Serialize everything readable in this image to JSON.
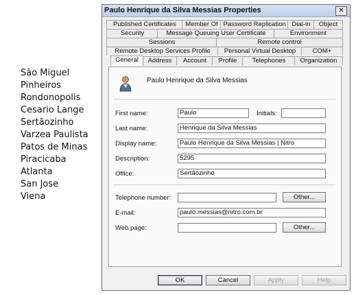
{
  "cities": [
    "São Miguel",
    "Pinheiros",
    "Rondonopolis",
    "Cesario Lange",
    "Sertãozinho",
    "Varzea Paulista",
    "Patos de Minas",
    "Piracicaba",
    "Atlanta",
    "San Jose",
    "Viena"
  ],
  "dialog": {
    "title": "Paulo Henrique da Silva Messias Properties",
    "close_glyph": "✕",
    "tabs_row1": [
      "Published Certificates",
      "Member Of",
      "Password Replication",
      "Dial-in",
      "Object"
    ],
    "tabs_row2": [
      "Security",
      "Message Queuing User Certificate",
      "Environment"
    ],
    "tabs_row3": [
      "Sessions",
      "Remote control"
    ],
    "tabs_row4": [
      "Remote Desktop Services Profile",
      "Personal Virtual Desktop",
      "COM+"
    ],
    "tabs_row5": [
      "General",
      "Address",
      "Account",
      "Profile",
      "Telephones",
      "Organization"
    ],
    "active_tab": "General",
    "user_display": "Paulo Henrique da Silva Messias",
    "labels": {
      "first_name": "First name:",
      "initials": "Initials:",
      "last_name": "Last name:",
      "display_name": "Display name:",
      "description": "Description:",
      "office": "Office:",
      "telephone": "Telephone number:",
      "email": "E-mail:",
      "web_page": "Web page:"
    },
    "values": {
      "first_name": "Paulo",
      "initials": "",
      "last_name": "Henrique da Silva Messias",
      "display_name": "Paulo Henrique da Silva Messias | Nitro",
      "description": "5295",
      "office": "Sertãozinho",
      "telephone": "",
      "email": "paulo.messias@nitro.com.br",
      "web_page": ""
    },
    "buttons": {
      "other_phone": "Other...",
      "other_web": "Other...",
      "ok": "OK",
      "cancel": "Cancel",
      "apply": "Apply",
      "help": "Help"
    }
  }
}
